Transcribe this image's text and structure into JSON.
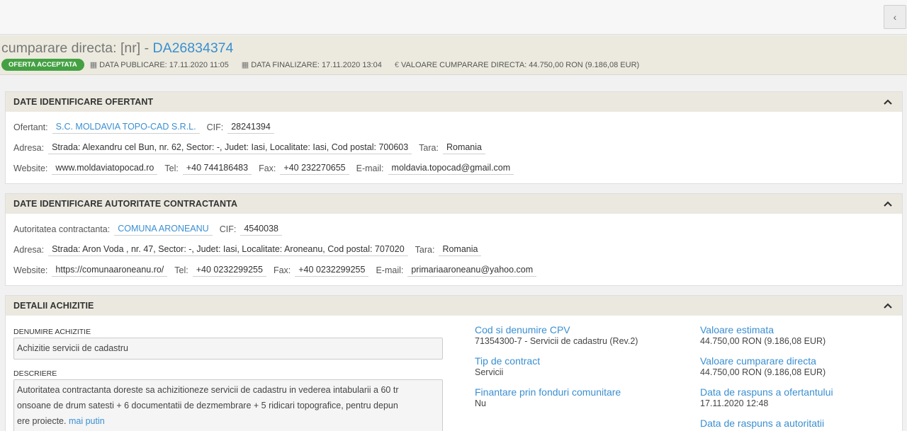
{
  "topbar": {
    "back_icon": "chevron-left-icon",
    "back_glyph": "‹"
  },
  "header": {
    "title_prefix": "cumparare directa: [nr] - ",
    "title_code": "DA26834374",
    "badge": "OFERTA ACCEPTATA",
    "publicare": "DATA PUBLICARE: 17.11.2020 11:05",
    "finalizare": "DATA FINALIZARE: 17.11.2020 13:04",
    "valoare": "VALOARE CUMPARARE DIRECTA: 44.750,00  RON (9.186,08  EUR)",
    "calendar_glyph": "▦",
    "euro_glyph": "€",
    "accent_color": "#3a8fd1",
    "badge_color": "#44a143"
  },
  "ofertant": {
    "title": "DATE IDENTIFICARE OFERTANT",
    "ofertant_label": "Ofertant:",
    "ofertant_value": "S.C. MOLDAVIA TOPO-CAD S.R.L.",
    "cif_label": "CIF:",
    "cif_value": "28241394",
    "adresa_label": "Adresa:",
    "adresa_value": "Strada: Alexandru cel Bun, nr. 62, Sector: -, Judet: Iasi, Localitate: Iasi, Cod postal: 700603",
    "tara_label": "Tara:",
    "tara_value": "Romania",
    "website_label": "Website:",
    "website_value": "www.moldaviatopocad.ro",
    "tel_label": "Tel:",
    "tel_value": "+40 744186483",
    "fax_label": "Fax:",
    "fax_value": "+40 232270655",
    "email_label": "E-mail:",
    "email_value": "moldavia.topocad@gmail.com"
  },
  "autoritate": {
    "title": "DATE IDENTIFICARE AUTORITATE CONTRACTANTA",
    "autoritate_label": "Autoritatea contractanta:",
    "autoritate_value": "COMUNA ARONEANU",
    "cif_label": "CIF:",
    "cif_value": "4540038",
    "adresa_label": "Adresa:",
    "adresa_value": "Strada: Aron Voda , nr. 47, Sector: -, Judet: Iasi, Localitate: Aroneanu, Cod postal: 707020",
    "tara_label": "Tara:",
    "tara_value": "Romania",
    "website_label": "Website:",
    "website_value": "https://comunaaroneanu.ro/",
    "tel_label": "Tel:",
    "tel_value": "+40 0232299255",
    "fax_label": "Fax:",
    "fax_value": "+40 0232299255",
    "email_label": "E-mail:",
    "email_value": "primariaaroneanu@yahoo.com"
  },
  "detalii": {
    "title": "DETALII ACHIZITIE",
    "denumire_label": "DENUMIRE ACHIZITIE",
    "denumire_value": "Achizitie servicii de cadastru",
    "descriere_label": "DESCRIERE",
    "descriere_line1": "Autoritatea contractanta doreste sa achizitioneze servicii de cadastru in vederea intabularii a 60 tr",
    "descriere_line2": "onsoane de drum satesti + 6 documentatii de dezmembrare + 5 ridicari topografice, pentru depun",
    "descriere_line3": "ere proiecte. ",
    "mai_putin": "mai putin",
    "cpv_title": "Cod si denumire CPV",
    "cpv_value": "71354300-7 - Servicii de cadastru (Rev.2)",
    "tip_title": "Tip de contract",
    "tip_value": "Servicii",
    "finantare_title": "Finantare prin fonduri comunitare",
    "finantare_value": "Nu",
    "val_estimata_title": "Valoare estimata",
    "val_estimata_value": "44.750,00  RON (9.186,08  EUR)",
    "val_cumparare_title": "Valoare cumparare directa",
    "val_cumparare_value": "44.750,00  RON (9.186,08  EUR)",
    "raspuns_ofertant_title": "Data de raspuns a ofertantului",
    "raspuns_ofertant_value": "17.11.2020 12:48",
    "raspuns_autoritate_title": "Data de raspuns a autoritatii"
  }
}
